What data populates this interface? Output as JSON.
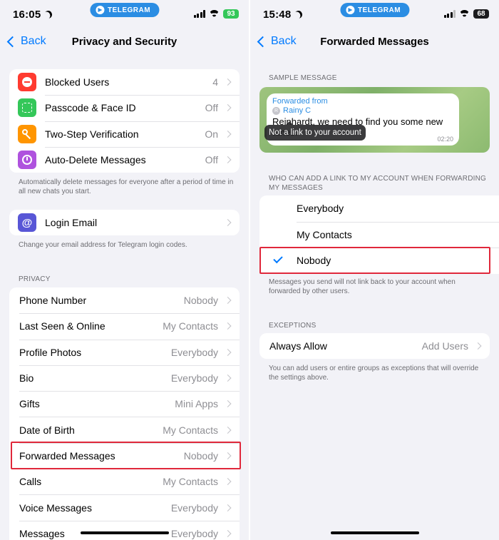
{
  "left": {
    "status": {
      "time": "16:05",
      "pill": "TELEGRAM",
      "battery": "93"
    },
    "nav": {
      "back": "Back",
      "title": "Privacy and Security"
    },
    "security_items": [
      {
        "label": "Blocked Users",
        "value": "4",
        "icon": "minus-circle-icon",
        "color": "#ff3b30"
      },
      {
        "label": "Passcode & Face ID",
        "value": "Off",
        "icon": "face-id-icon",
        "color": "#34c759"
      },
      {
        "label": "Two-Step Verification",
        "value": "On",
        "icon": "key-icon",
        "color": "#ff9500"
      },
      {
        "label": "Auto-Delete Messages",
        "value": "Off",
        "icon": "timer-icon",
        "color": "#af52de"
      }
    ],
    "auto_delete_note": "Automatically delete messages for everyone after a period of time in all new chats you start.",
    "login_email": {
      "label": "Login Email",
      "icon": "at-sign-icon",
      "color": "#5856d6"
    },
    "login_email_note": "Change your email address for Telegram login codes.",
    "privacy_header": "PRIVACY",
    "privacy_items": [
      {
        "label": "Phone Number",
        "value": "Nobody"
      },
      {
        "label": "Last Seen & Online",
        "value": "My Contacts"
      },
      {
        "label": "Profile Photos",
        "value": "Everybody"
      },
      {
        "label": "Bio",
        "value": "Everybody"
      },
      {
        "label": "Gifts",
        "value": "Mini Apps"
      },
      {
        "label": "Date of Birth",
        "value": "My Contacts"
      },
      {
        "label": "Forwarded Messages",
        "value": "Nobody"
      },
      {
        "label": "Calls",
        "value": "My Contacts"
      },
      {
        "label": "Voice Messages",
        "value": "Everybody"
      },
      {
        "label": "Messages",
        "value": "Everybody"
      }
    ]
  },
  "right": {
    "status": {
      "time": "15:48",
      "pill": "TELEGRAM",
      "battery": "68"
    },
    "nav": {
      "back": "Back",
      "title": "Forwarded Messages"
    },
    "sample_header": "SAMPLE MESSAGE",
    "sample": {
      "forwarded_from": "Forwarded from",
      "avatar_initial": "R",
      "name": "Rainy C",
      "message": "Reinhardt, we need to find you some new tunes.",
      "time": "02:20",
      "tooltip": "Not a link to your account"
    },
    "who_header": "WHO CAN ADD A LINK TO MY ACCOUNT WHEN FORWARDING MY MESSAGES",
    "options": [
      {
        "label": "Everybody",
        "selected": false
      },
      {
        "label": "My Contacts",
        "selected": false
      },
      {
        "label": "Nobody",
        "selected": true
      }
    ],
    "options_note": "Messages you send will not link back to your account when forwarded by other users.",
    "exceptions_header": "EXCEPTIONS",
    "always_allow": {
      "label": "Always Allow",
      "value": "Add Users"
    },
    "exceptions_note": "You can add users or entire groups as exceptions that will override the settings above."
  }
}
